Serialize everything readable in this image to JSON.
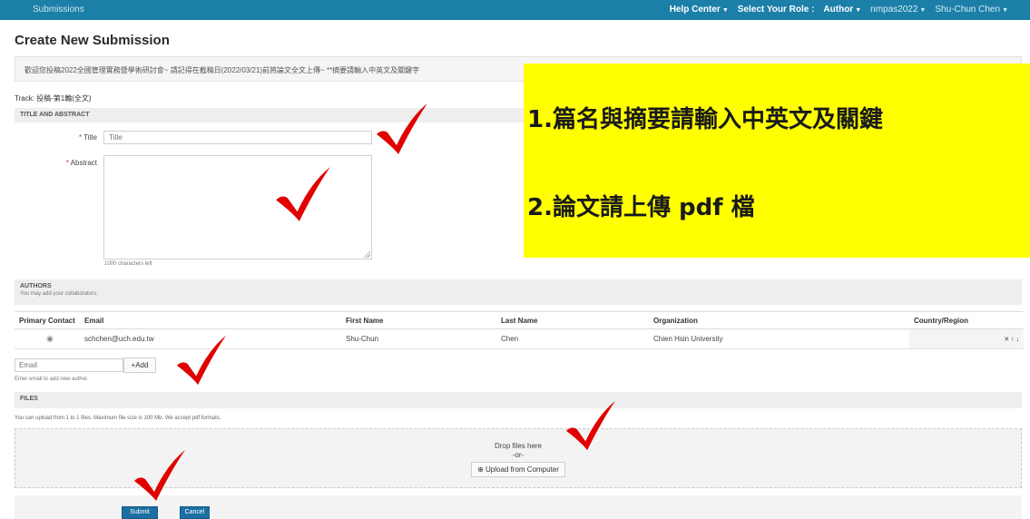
{
  "topbar": {
    "brand": "Submissions",
    "help_center": "Help Center",
    "select_role_label": "Select Your Role :",
    "role": "Author",
    "account": "nmpas2022",
    "user": "Shu-Chun Chen"
  },
  "page_title": "Create New Submission",
  "notice": "歡迎您投稿2022全國管理實務暨學術研討會~ 請記得在截稿日(2022/03/21)前將論文全文上傳~ **摘要請輸入中英文及關鍵字",
  "track": "Track: 投稿-第1輪(全文)",
  "title_abstract": {
    "section_label": "TITLE AND ABSTRACT",
    "title_label": "Title",
    "title_placeholder": "Title",
    "abstract_label": "Abstract",
    "chars_left": "1000 characters left",
    "required_mark": "*"
  },
  "authors": {
    "section_label": "AUTHORS",
    "section_sub": "You may add your collaborators.",
    "columns": [
      "Primary Contact",
      "Email",
      "First Name",
      "Last Name",
      "Organization",
      "Country/Region"
    ],
    "rows": [
      {
        "radio": "◉",
        "email": "schchen@uch.edu.tw",
        "first_name": "Shu-Chun",
        "last_name": "Chen",
        "organization": "Chien Hsin University",
        "country": "",
        "actions": "✕  ↑ ↓"
      }
    ],
    "email_placeholder": "Email",
    "add_label": "+Add",
    "help_text": "Enter email to add new author."
  },
  "files": {
    "section_label": "FILES",
    "note": "You can upload from 1 to 1 files. Maximum file size is 100 Mb. We accept pdf formats.",
    "drop_label": "Drop files here",
    "or_label": "-or-",
    "upload_label": "⊕ Upload from Computer"
  },
  "buttons": {
    "submit": "Submit",
    "cancel": "Cancel"
  },
  "overlay": {
    "line1": "1.篇名與摘要請輸入中英文及關鍵",
    "line2": "2.論文請上傳 pdf 檔"
  },
  "colors": {
    "topbar": "#1b7fa8",
    "primary_button": "#1b6fa2",
    "overlay_background": "#ffff00",
    "checkmark": "#e00000"
  },
  "icons": [
    "checkmark-icon",
    "upload-icon",
    "remove-icon",
    "reorder-icon"
  ]
}
